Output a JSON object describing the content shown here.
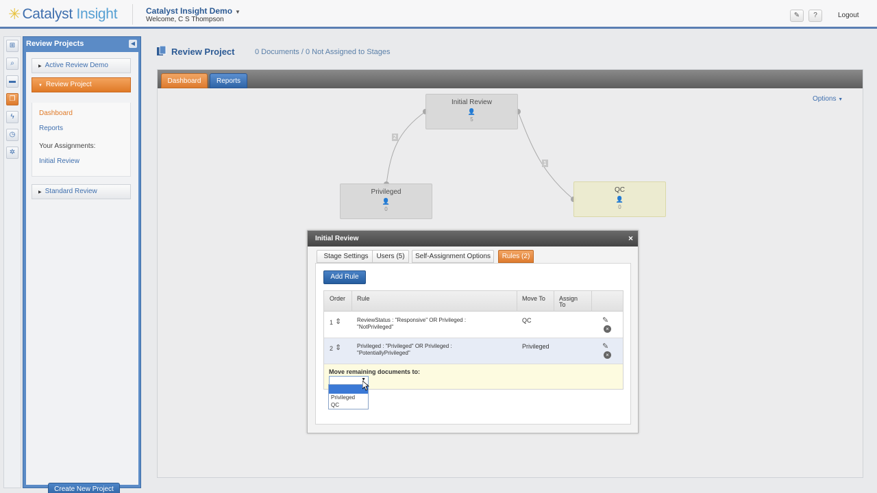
{
  "header": {
    "logo_text_a": "Catalyst",
    "logo_text_b": "Insight",
    "app_title": "Catalyst Insight Demo",
    "welcome": "Welcome, C S Thompson",
    "help_label": "?",
    "logout_label": "Logout"
  },
  "sidebar": {
    "title": "Review Projects",
    "projects": [
      {
        "label": "Active Review Demo"
      },
      {
        "label": "Review Project"
      },
      {
        "label": "Standard Review"
      }
    ],
    "sub_items": {
      "dashboard": "Dashboard",
      "reports": "Reports",
      "assignments_label": "Your Assignments:",
      "initial_review": "Initial Review"
    },
    "create_button": "Create New Project"
  },
  "main": {
    "title": "Review Project",
    "subtitle": "0 Documents / 0 Not Assigned to Stages",
    "tabs": [
      {
        "label": "Dashboard"
      },
      {
        "label": "Reports"
      }
    ],
    "options_label": "Options",
    "stages": [
      {
        "name": "Initial Review",
        "count": "5"
      },
      {
        "name": "Privileged",
        "count": "0"
      },
      {
        "name": "QC",
        "count": "0"
      }
    ],
    "connector_labels": [
      "2",
      "1"
    ]
  },
  "dialog": {
    "title": "Initial Review",
    "close_icon": "×",
    "tabs": [
      {
        "label": "Stage Settings"
      },
      {
        "label": "Users (5)"
      },
      {
        "label": "Self-Assignment Options"
      },
      {
        "label": "Rules (2)"
      }
    ],
    "add_rule_label": "Add Rule",
    "columns": {
      "order": "Order",
      "rule": "Rule",
      "move_to": "Move To",
      "assign_to_a": "Assign",
      "assign_to_b": "To"
    },
    "rules": [
      {
        "order": "1",
        "rule_a": "ReviewStatus : \"Responsive\" OR Privileged :",
        "rule_b": "\"NotPrivileged\"",
        "move_to": "QC"
      },
      {
        "order": "2",
        "rule_a": "Privileged : \"Privileged\" OR Privileged :",
        "rule_b": "\"PotentiallyPrivileged\"",
        "move_to": "Privileged"
      }
    ],
    "remaining_label": "Move remaining documents to:",
    "dropdown_options": [
      "",
      "Privileged",
      "QC"
    ]
  },
  "colors": {
    "accent_orange": "#e07a27",
    "accent_blue": "#2f64a6",
    "header_blue": "#2c5a94"
  }
}
